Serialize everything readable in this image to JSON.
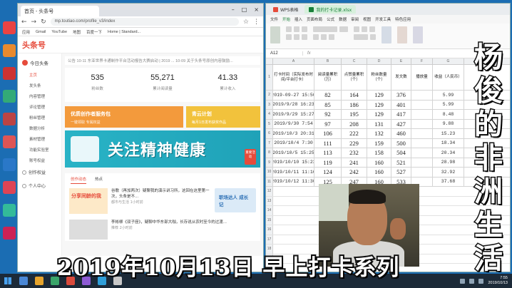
{
  "browser": {
    "tab_title": "首页 - 头条号",
    "url": "mp.toutiao.com/profile_v3/index",
    "bookmarks": [
      "应用",
      "Gmail",
      "YouTube",
      "地图",
      "百度一下",
      "Home | Standard..."
    ],
    "site_logo": "头条号",
    "sidebar": {
      "brand": "今日头条",
      "items": [
        "主页",
        "发头条",
        "内容管理",
        "评论管理",
        "粉丝管理",
        "数据分析",
        "素材管理",
        "功能实验室",
        "账号权益"
      ],
      "sections": [
        "创作权益",
        "个人中心"
      ]
    },
    "notice": "公告  10-11 东亚世界卡通制作平台活动报告大赛启动 | 2019 ...  10-09 关于头条号原创内容鼓励...",
    "stats": [
      {
        "value": "535",
        "label": "粉丝数"
      },
      {
        "value": "55,271",
        "label": "累计阅读量"
      },
      {
        "value": "41.33",
        "label": "累计收入"
      }
    ],
    "banner_left": {
      "title": "优质创作者服务包",
      "sub": "一键领取 专属权益"
    },
    "banner_right": {
      "title": "青云计划",
      "sub": "每月1日发布获奖作品"
    },
    "health_banner": "关注精神健康",
    "health_badge": "重要活动",
    "feed_tabs": [
      "创作动态",
      "热点"
    ],
    "feed": [
      {
        "thumb": "分享同龄的我",
        "title": "谷歌（再加两次）疑聊我的演示讲习所，这回在这里第一次，头条是不...",
        "meta": "都市与生活 1小时前"
      },
      {
        "thumb": "",
        "title": "李彬柳《双子座》，疑聊中华东部大咖，长存说从农时至今的过渡...",
        "meta": "推荐 2小时前"
      }
    ],
    "feed_card": "职场达人\n成长记"
  },
  "sheet": {
    "tabs": [
      {
        "label": "WPS表格"
      },
      {
        "label": "我的打卡记录.xlsx"
      }
    ],
    "menu": [
      "文件",
      "开始",
      "插入",
      "页面布局",
      "公式",
      "数据",
      "审阅",
      "视图",
      "开发工具",
      "特色应用"
    ],
    "name_box": "A12",
    "fx": "fx",
    "columns": [
      "A",
      "B",
      "C",
      "D",
      "E",
      "F",
      "G"
    ],
    "headers": [
      "打卡时间（实际发布时间/平台打卡）",
      "阅读量累积（万）",
      "点赞量累积（个）",
      "粉丝数量（个）",
      "发文数",
      "播放量",
      "收益（人民币）"
    ],
    "rows": [
      {
        "n": "2",
        "a": "2019-09-27 15:50",
        "b": "82",
        "c": "164",
        "d": "129",
        "e": "376",
        "f": "",
        "g": "5.99"
      },
      {
        "n": "3",
        "a": "2019/9/28 16:23",
        "b": "85",
        "c": "186",
        "d": "129",
        "e": "401",
        "f": "",
        "g": "5.99"
      },
      {
        "n": "4",
        "a": "2019/9/29 15:27",
        "b": "92",
        "c": "195",
        "d": "129",
        "e": "417",
        "f": "",
        "g": "8.48"
      },
      {
        "n": "5",
        "a": "2019/9/30 7:54",
        "b": "97",
        "c": "208",
        "d": "131",
        "e": "427",
        "f": "",
        "g": "9.88"
      },
      {
        "n": "6",
        "a": "2019/10/3 20:31",
        "b": "106",
        "c": "222",
        "d": "132",
        "e": "460",
        "f": "",
        "g": "15.23"
      },
      {
        "n": "7",
        "a": "2019/10/4 7:30",
        "b": "111",
        "c": "229",
        "d": "159",
        "e": "500",
        "f": "",
        "g": "18.34"
      },
      {
        "n": "8",
        "a": "2019/10/5 15:25",
        "b": "113",
        "c": "232",
        "d": "158",
        "e": "504",
        "f": "",
        "g": "20.34"
      },
      {
        "n": "9",
        "a": "2019/10/10 15:23",
        "b": "119",
        "c": "241",
        "d": "160",
        "e": "521",
        "f": "",
        "g": "28.98"
      },
      {
        "n": "10",
        "a": "2019/10/11 11:16",
        "b": "124",
        "c": "242",
        "d": "160",
        "e": "527",
        "f": "",
        "g": "32.92"
      },
      {
        "n": "11",
        "a": "2019/10/12 11:30",
        "b": "125",
        "c": "247",
        "d": "160",
        "e": "533",
        "f": "",
        "g": "37.68"
      }
    ],
    "empty_rows": [
      "12",
      "13",
      "14",
      "15",
      "16",
      "17",
      "18",
      "19",
      "20"
    ]
  },
  "overlay": {
    "vertical_title": [
      "杨",
      "俊",
      "的",
      "非",
      "洲",
      "生",
      "活"
    ],
    "caption": "2019年10月13日  早上打卡系列"
  },
  "taskbar": {
    "clock_time": "7:55",
    "clock_date": "2019/10/13"
  },
  "colors": {
    "toutiao_red": "#e64b3b",
    "wps_green": "#19803a",
    "desktop_blue": "#1b6db3"
  }
}
